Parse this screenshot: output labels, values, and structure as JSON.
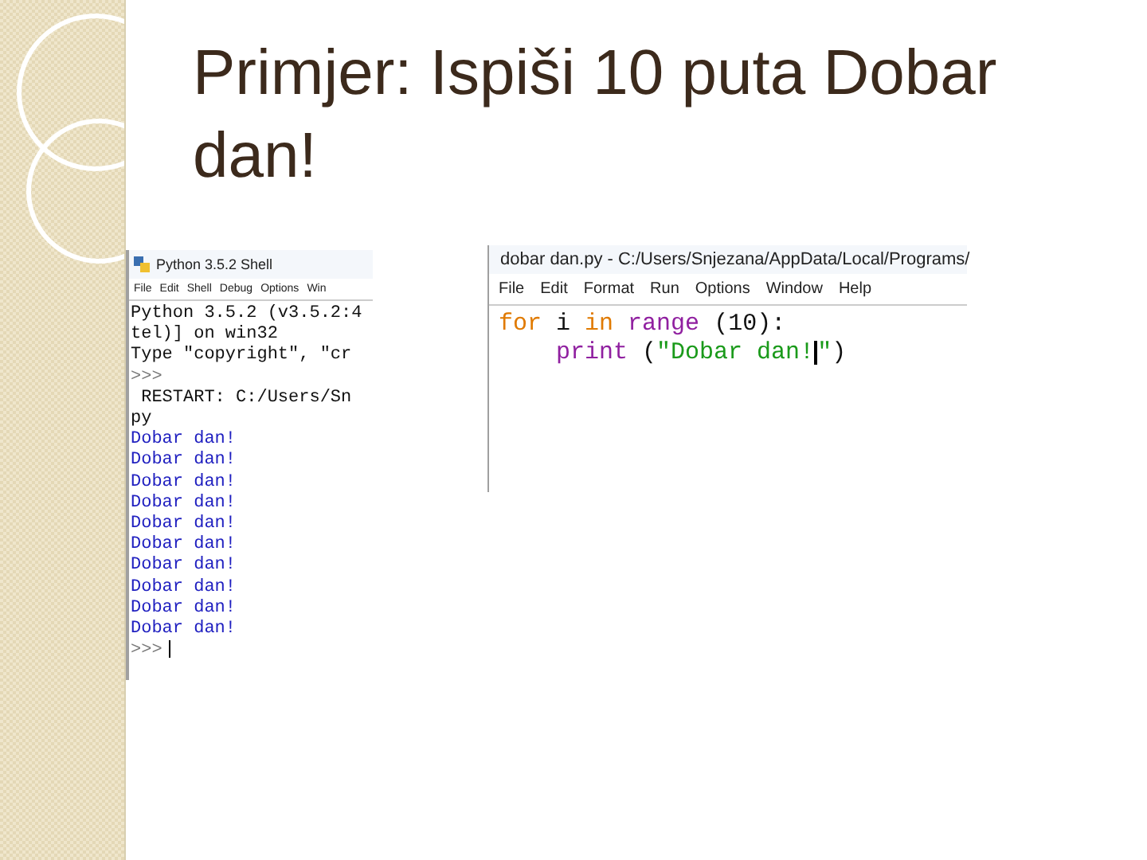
{
  "slide": {
    "title": "Primjer: Ispiši 10 puta Dobar dan!"
  },
  "shell": {
    "title": "Python 3.5.2 Shell",
    "menu": [
      "File",
      "Edit",
      "Shell",
      "Debug",
      "Options",
      "Win"
    ],
    "lines": [
      {
        "kind": "info",
        "text": "Python 3.5.2 (v3.5.2:4"
      },
      {
        "kind": "info",
        "text": "tel)] on win32"
      },
      {
        "kind": "info",
        "text": "Type \"copyright\", \"cr"
      },
      {
        "kind": "prompt",
        "text": ">>>"
      },
      {
        "kind": "info",
        "text": " RESTART: C:/Users/Sn"
      },
      {
        "kind": "info",
        "text": "py"
      },
      {
        "kind": "output",
        "text": "Dobar dan!"
      },
      {
        "kind": "output",
        "text": "Dobar dan!"
      },
      {
        "kind": "output",
        "text": "Dobar dan!"
      },
      {
        "kind": "output",
        "text": "Dobar dan!"
      },
      {
        "kind": "output",
        "text": "Dobar dan!"
      },
      {
        "kind": "output",
        "text": "Dobar dan!"
      },
      {
        "kind": "output",
        "text": "Dobar dan!"
      },
      {
        "kind": "output",
        "text": "Dobar dan!"
      },
      {
        "kind": "output",
        "text": "Dobar dan!"
      },
      {
        "kind": "output",
        "text": "Dobar dan!"
      },
      {
        "kind": "prompt",
        "text": ">>>",
        "cursor": true
      }
    ]
  },
  "editor": {
    "title": "dobar dan.py - C:/Users/Snjezana/AppData/Local/Programs/",
    "menu": [
      "File",
      "Edit",
      "Format",
      "Run",
      "Options",
      "Window",
      "Help"
    ],
    "lines": [
      [
        {
          "kind": "keyword",
          "text": "for"
        },
        {
          "kind": "plain",
          "text": " i "
        },
        {
          "kind": "keyword",
          "text": "in"
        },
        {
          "kind": "builtin",
          "text": " range"
        },
        {
          "kind": "plain",
          "text": " (10):"
        }
      ],
      [
        {
          "kind": "builtin",
          "text": "    print"
        },
        {
          "kind": "plain",
          "text": " ("
        },
        {
          "kind": "string",
          "text": "\"Dobar dan!"
        },
        {
          "kind": "cursor"
        },
        {
          "kind": "string",
          "text": "\""
        },
        {
          "kind": "plain",
          "text": ")"
        }
      ]
    ]
  }
}
